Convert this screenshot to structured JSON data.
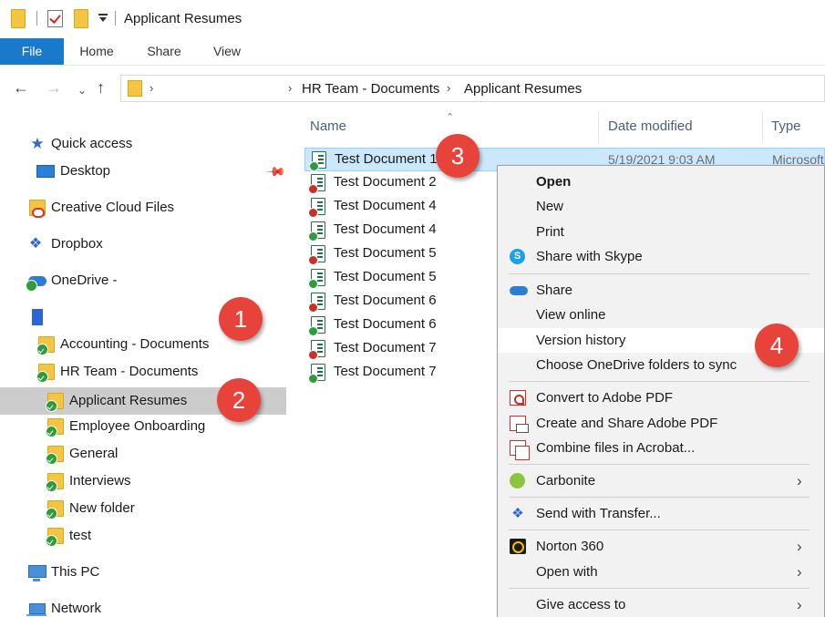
{
  "window": {
    "title": "Applicant Resumes"
  },
  "ribbon": {
    "tabs": [
      "File",
      "Home",
      "Share",
      "View"
    ]
  },
  "address": {
    "crumbs": [
      "HR Team - Documents",
      "Applicant Resumes"
    ]
  },
  "nav": {
    "items": [
      {
        "label": "Quick access"
      },
      {
        "label": "Desktop"
      },
      {
        "label": "Creative Cloud Files"
      },
      {
        "label": "Dropbox"
      },
      {
        "label": "OneDrive -"
      },
      {
        "label": ""
      },
      {
        "label": "Accounting - Documents"
      },
      {
        "label": "HR Team - Documents"
      },
      {
        "label": "Applicant Resumes"
      },
      {
        "label": "Employee Onboarding"
      },
      {
        "label": "General"
      },
      {
        "label": "Interviews"
      },
      {
        "label": "New folder"
      },
      {
        "label": "test"
      },
      {
        "label": "This PC"
      },
      {
        "label": "Network"
      }
    ]
  },
  "columns": {
    "name": "Name",
    "date": "Date modified",
    "type": "Type"
  },
  "files": [
    {
      "name": "Test Document 1",
      "date": "5/19/2021 9:03 AM",
      "type": "Microsoft",
      "badge": "green"
    },
    {
      "name": "Test Document 2",
      "badge": "red"
    },
    {
      "name": "Test Document 4",
      "badge": "red"
    },
    {
      "name": "Test Document 4",
      "badge": "green"
    },
    {
      "name": "Test Document 5",
      "badge": "red"
    },
    {
      "name": "Test Document 5",
      "badge": "green"
    },
    {
      "name": "Test Document 6",
      "badge": "red"
    },
    {
      "name": "Test Document 6",
      "badge": "green"
    },
    {
      "name": "Test Document 7",
      "badge": "red"
    },
    {
      "name": "Test Document 7",
      "badge": "green"
    }
  ],
  "context_menu": {
    "items": [
      {
        "label": "Open",
        "bold": true
      },
      {
        "label": "New"
      },
      {
        "label": "Print"
      },
      {
        "label": "Share with Skype",
        "icon": "skype-icon"
      },
      {
        "label": "Share",
        "icon": "onedrive-cloud-icon"
      },
      {
        "label": "View online"
      },
      {
        "label": "Version history",
        "highlighted": true
      },
      {
        "label": "Choose OneDrive folders to sync"
      },
      {
        "label": "Convert to Adobe PDF",
        "icon": "adobe-pdf-icon"
      },
      {
        "label": "Create and Share Adobe PDF",
        "icon": "adobe-share-icon"
      },
      {
        "label": "Combine files in Acrobat...",
        "icon": "acrobat-combine-icon"
      },
      {
        "label": "Carbonite",
        "icon": "carbonite-icon",
        "submenu": true
      },
      {
        "label": "Send with Transfer...",
        "icon": "dropbox-transfer-icon"
      },
      {
        "label": "Norton 360",
        "icon": "norton-icon",
        "submenu": true
      },
      {
        "label": "Open with",
        "submenu": true
      },
      {
        "label": "Give access to",
        "submenu": true
      }
    ]
  },
  "callouts": [
    "1",
    "2",
    "3",
    "4"
  ],
  "colors": {
    "accent": "#1979ca",
    "callout": "#e8433a",
    "selection": "#cce8ff",
    "nav_selected": "#cccccc"
  }
}
